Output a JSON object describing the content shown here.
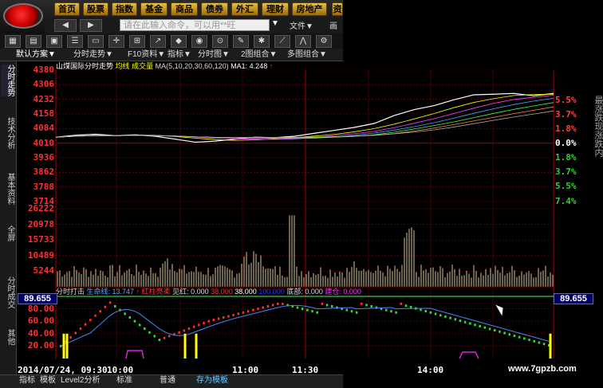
{
  "nav": {
    "tabs": [
      "首页",
      "股票",
      "指数",
      "基金",
      "商品",
      "债券",
      "外汇",
      "理财",
      "房地产",
      "资"
    ]
  },
  "toolbar": {
    "command_placeholder": "请在此输入命令，可以用**旺",
    "file_menu": "文件▼",
    "extra": "画"
  },
  "tabbar": {
    "tabs": [
      "默认方案",
      "分时走势",
      "F10资料",
      "指标",
      "分时图",
      "2图组合",
      "多图组合"
    ]
  },
  "chart_header": {
    "stock": "山煤国际分时走势",
    "avg": "均线",
    "volume": "成交量",
    "ma": "MA(5,10,20,30,60,120)",
    "ma1": "MA1: 4.248",
    "arrow": "↑"
  },
  "left_tabs": [
    "分时走势",
    "技术分析",
    "基本资料",
    "全屏",
    "分时成交",
    "其他"
  ],
  "chart_data": [
    {
      "type": "line",
      "title": "山煤国际分时走势",
      "x": [
        "09:30",
        "10:00",
        "11:00",
        "11:30",
        "14:00"
      ],
      "yticks": [
        4380,
        4306,
        4232,
        4158,
        4084,
        4010,
        3936,
        3862,
        3788,
        3714
      ],
      "pct_ticks": [
        "5.5%",
        "3.7%",
        "1.8%",
        "0.0%",
        "1.8%",
        "3.7%",
        "5.5%",
        "7.4%"
      ],
      "ylim": [
        3714,
        4380
      ],
      "price": [
        4040,
        4050,
        4055,
        4048,
        4052,
        4045,
        4030,
        4015,
        4020,
        4030,
        4040,
        4038,
        4045,
        4060,
        4075,
        4090,
        4110,
        4150,
        4180,
        4200,
        4230,
        4255,
        4258,
        4262,
        4250,
        4262
      ]
    },
    {
      "type": "bar",
      "title": "成交量",
      "yticks": [
        26222,
        20978,
        15733,
        10489,
        5244
      ],
      "ylim": [
        0,
        26222
      ]
    },
    {
      "type": "line",
      "title": "分时打击",
      "yticks": [
        80,
        60,
        40,
        20
      ],
      "ylim": [
        0,
        100
      ]
    }
  ],
  "indicator": {
    "label": "分时打击",
    "life_line": "生命线: 13.747",
    "arrow": "↑",
    "red_up": "红柱亮柔",
    "see_red": "见红: 0.000",
    "v1": "38.000",
    "v2": "38.000",
    "v3": "100.000",
    "bottom": "底部: 0.000",
    "safe": "建仓: 0.000",
    "left_value": "89.655",
    "right_value": "89.655"
  },
  "time_labels": {
    "date_start": "2014/07/24, 09:30",
    "t1": "10:00",
    "t2": "11:00",
    "t3": "11:30",
    "t4": "14:00"
  },
  "bottom_tabs": [
    "指标",
    "模板",
    "Level2分析",
    "标准",
    "普通",
    "存为模板"
  ],
  "watermark": "www.7gpzb.com",
  "right_side_text": "最涨跌现涨跌内",
  "colors": {
    "price_axis": "#ff3030",
    "pct_up": "#ff4040",
    "pct_down": "#30d030",
    "zero": "#ffffff",
    "volume_bar": "#d4c89a",
    "grid": "#8b0000",
    "indicator_bg": "#000064"
  }
}
